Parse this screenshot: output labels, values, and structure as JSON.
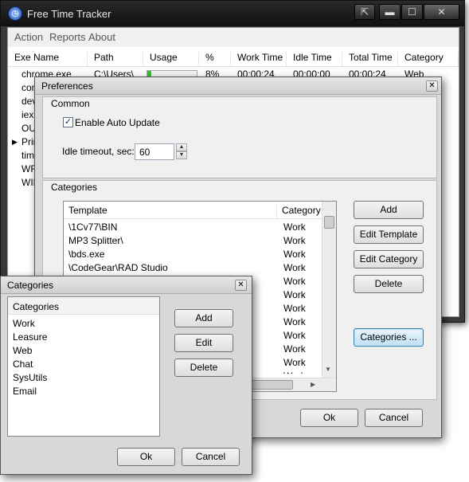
{
  "main": {
    "title": "Free Time Tracker",
    "menu": [
      "Action",
      "Reports",
      "About"
    ],
    "columns": [
      "Exe Name",
      "Path",
      "Usage",
      "%",
      "Work Time",
      "Idle Time",
      "Total Time",
      "Category"
    ],
    "rows": [
      {
        "exe": "chrome.exe",
        "path": "C:\\Users\\",
        "pct": "8%",
        "work": "00:00:24",
        "idle": "00:00:00",
        "total": "00:00:24",
        "category": "Web",
        "usage": 0.08
      },
      {
        "exe": "com",
        "path": "",
        "pct": "",
        "work": "",
        "idle": "",
        "total": "",
        "category": "",
        "usage": 0.03
      },
      {
        "exe": "dev",
        "path": "",
        "pct": "",
        "work": "",
        "idle": "",
        "total": "",
        "category": "",
        "usage": 0
      },
      {
        "exe": "iexp",
        "path": "",
        "pct": "",
        "work": "",
        "idle": "",
        "total": "",
        "category": "",
        "usage": 0
      },
      {
        "exe": "OUT",
        "path": "",
        "pct": "",
        "work": "",
        "idle": "",
        "total": "",
        "category": "",
        "usage": 0
      },
      {
        "exe": "Prin",
        "path": "",
        "pct": "",
        "work": "",
        "idle": "",
        "total": "",
        "category": "",
        "usage": 0
      },
      {
        "exe": "time",
        "path": "",
        "pct": "",
        "work": "",
        "idle": "",
        "total": "",
        "category": "",
        "usage": 0
      },
      {
        "exe": "WFI",
        "path": "",
        "pct": "",
        "work": "",
        "idle": "",
        "total": "",
        "category": "",
        "usage": 0
      },
      {
        "exe": "WIN",
        "path": "",
        "pct": "",
        "work": "",
        "idle": "",
        "total": "",
        "category": "",
        "usage": 0
      }
    ],
    "row_pointer_glyph": "▶"
  },
  "prefs": {
    "title": "Preferences",
    "common_label": "Common",
    "auto_update_label": "Enable Auto Update",
    "auto_update_checked": true,
    "idle_label": "Idle timeout, sec:",
    "idle_value": "60",
    "categories_label": "Categories",
    "columns": [
      "Template",
      "Category"
    ],
    "templates": [
      {
        "template": "\\1Cv77\\BIN",
        "category": "Work"
      },
      {
        "template": "MP3 Splitter\\",
        "category": "Work"
      },
      {
        "template": "\\bds.exe",
        "category": "Work"
      },
      {
        "template": "\\CodeGear\\RAD Studio",
        "category": "Work"
      },
      {
        "template": "",
        "category": "Work"
      },
      {
        "template": "",
        "category": "Work"
      },
      {
        "template": "",
        "category": "Work"
      },
      {
        "template": "",
        "category": "Work"
      },
      {
        "template": "",
        "category": "Work"
      },
      {
        "template": "",
        "category": "Work"
      },
      {
        "template": "",
        "category": "Work"
      },
      {
        "template": "",
        "category": "Work"
      }
    ],
    "buttons": {
      "add": "Add",
      "edit_template": "Edit Template",
      "edit_category": "Edit Category",
      "delete": "Delete",
      "categories": "Categories ...",
      "ok": "Ok",
      "cancel": "Cancel"
    }
  },
  "cats": {
    "title": "Categories",
    "header": "Categories",
    "items": [
      "Work",
      "Leasure",
      "Web",
      "Chat",
      "SysUtils",
      "Email"
    ],
    "buttons": {
      "add": "Add",
      "edit": "Edit",
      "delete": "Delete",
      "ok": "Ok",
      "cancel": "Cancel"
    }
  },
  "glyphs": {
    "close": "✕",
    "minimize": "▬",
    "maximize": "☐",
    "restore": "⇱",
    "up": "▲",
    "down": "▼",
    "left": "◀",
    "right": "▶",
    "check": "✓"
  },
  "colors": {
    "usage_bar": "#2fc62f",
    "focus_border": "#3c7fb1"
  }
}
